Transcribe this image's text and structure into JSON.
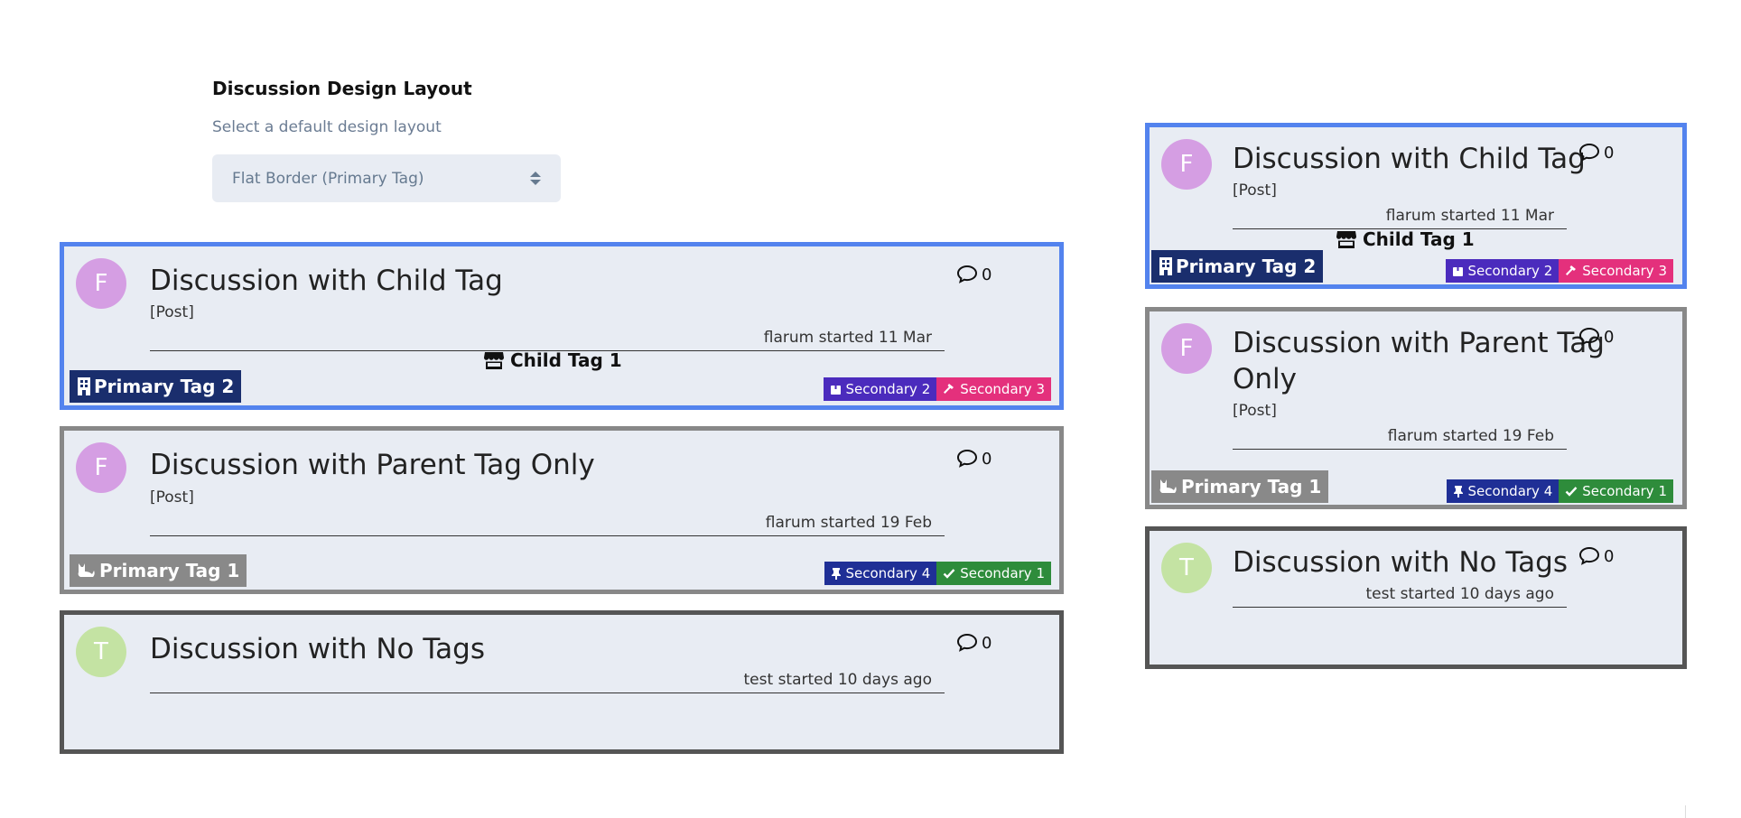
{
  "setting": {
    "title": "Discussion Design Layout",
    "help": "Select a default design layout",
    "selected": "Flat Border (Primary Tag)"
  },
  "colors": {
    "card_bg": "#e8ecf3",
    "border_child": "#5383ee",
    "border_parent": "#888888",
    "border_none": "#555555",
    "primary_tag_2": "#1a2e6d",
    "primary_tag_1": "#898989",
    "secondary_2": "#4b2bbd",
    "secondary_3": "#e4307c",
    "secondary_4": "#1f2f96",
    "secondary_1": "#2e8c3b"
  },
  "icons": {
    "replies": "speech-bubble-icon",
    "child_tag": "store-icon",
    "primary_tag_2": "building-icon",
    "primary_tag_1": "cat-icon",
    "secondary_2": "box-icon",
    "secondary_3": "hammer-icon",
    "secondary_4": "thumbtack-icon",
    "secondary_1": "check-icon"
  },
  "discussions": [
    {
      "title": "Discussion with Child Tag",
      "avatar": "F",
      "post": "[Post]",
      "meta": "flarum started 11 Mar",
      "replies": "0",
      "child_tag": "Child Tag 1",
      "primary_tag": "Primary Tag 2",
      "secondary_tags": [
        "Secondary 2",
        "Secondary 3"
      ]
    },
    {
      "title": "Discussion with Parent Tag Only",
      "avatar": "F",
      "post": "[Post]",
      "meta": "flarum started 19 Feb",
      "replies": "0",
      "primary_tag": "Primary Tag 1",
      "secondary_tags": [
        "Secondary 4",
        "Secondary 1"
      ]
    },
    {
      "title": "Discussion with No Tags",
      "avatar": "T",
      "meta": "test started 10 days ago",
      "replies": "0"
    }
  ],
  "narrow_titles": {
    "parent_line1": "Discussion with Parent Tag",
    "parent_line2": "Only"
  }
}
